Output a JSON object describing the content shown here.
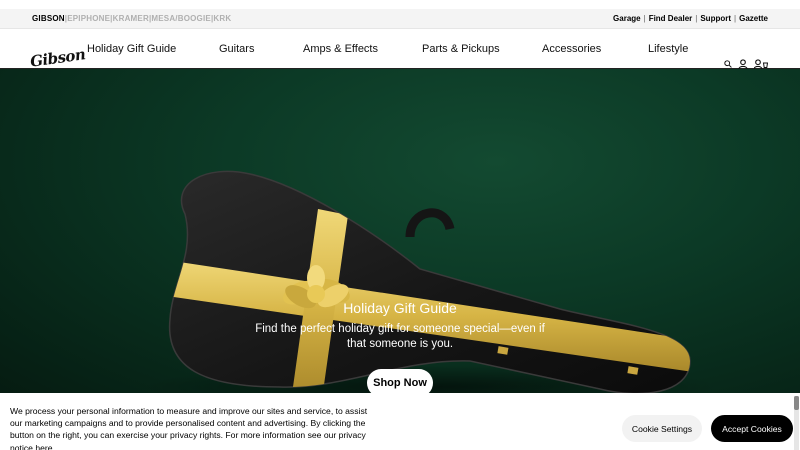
{
  "topbar": {
    "brands": [
      "GIBSON",
      "EPIPHONE",
      "KRAMER",
      "MESA/BOOGIE",
      "KRK"
    ],
    "links": [
      "Garage",
      "Find Dealer",
      "Support",
      "Gazette"
    ]
  },
  "nav": {
    "logo": "Gibson",
    "items": [
      "Holiday Gift Guide",
      "Guitars",
      "Amps & Effects",
      "Parts & Pickups",
      "Accessories",
      "Lifestyle"
    ],
    "icons": [
      "search-icon",
      "account-icon",
      "cart-icon"
    ]
  },
  "hero": {
    "title": "Holiday Gift Guide",
    "subtitle": "Find the perfect holiday gift for someone special—even if that someone is you.",
    "cta": "Shop Now"
  },
  "cookie": {
    "text": "We process your personal information to measure and improve our sites and service, to assist our marketing campaigns and to provide personalised content and advertising. By clicking the button on the right, you can exercise your privacy rights. For more information see our privacy notice",
    "link": "here",
    "settings_label": "Cookie Settings",
    "accept_label": "Accept Cookies"
  },
  "colors": {
    "hero_bg": "#0c3a26",
    "ribbon": "#d9b84a",
    "accept_bg": "#000000"
  }
}
